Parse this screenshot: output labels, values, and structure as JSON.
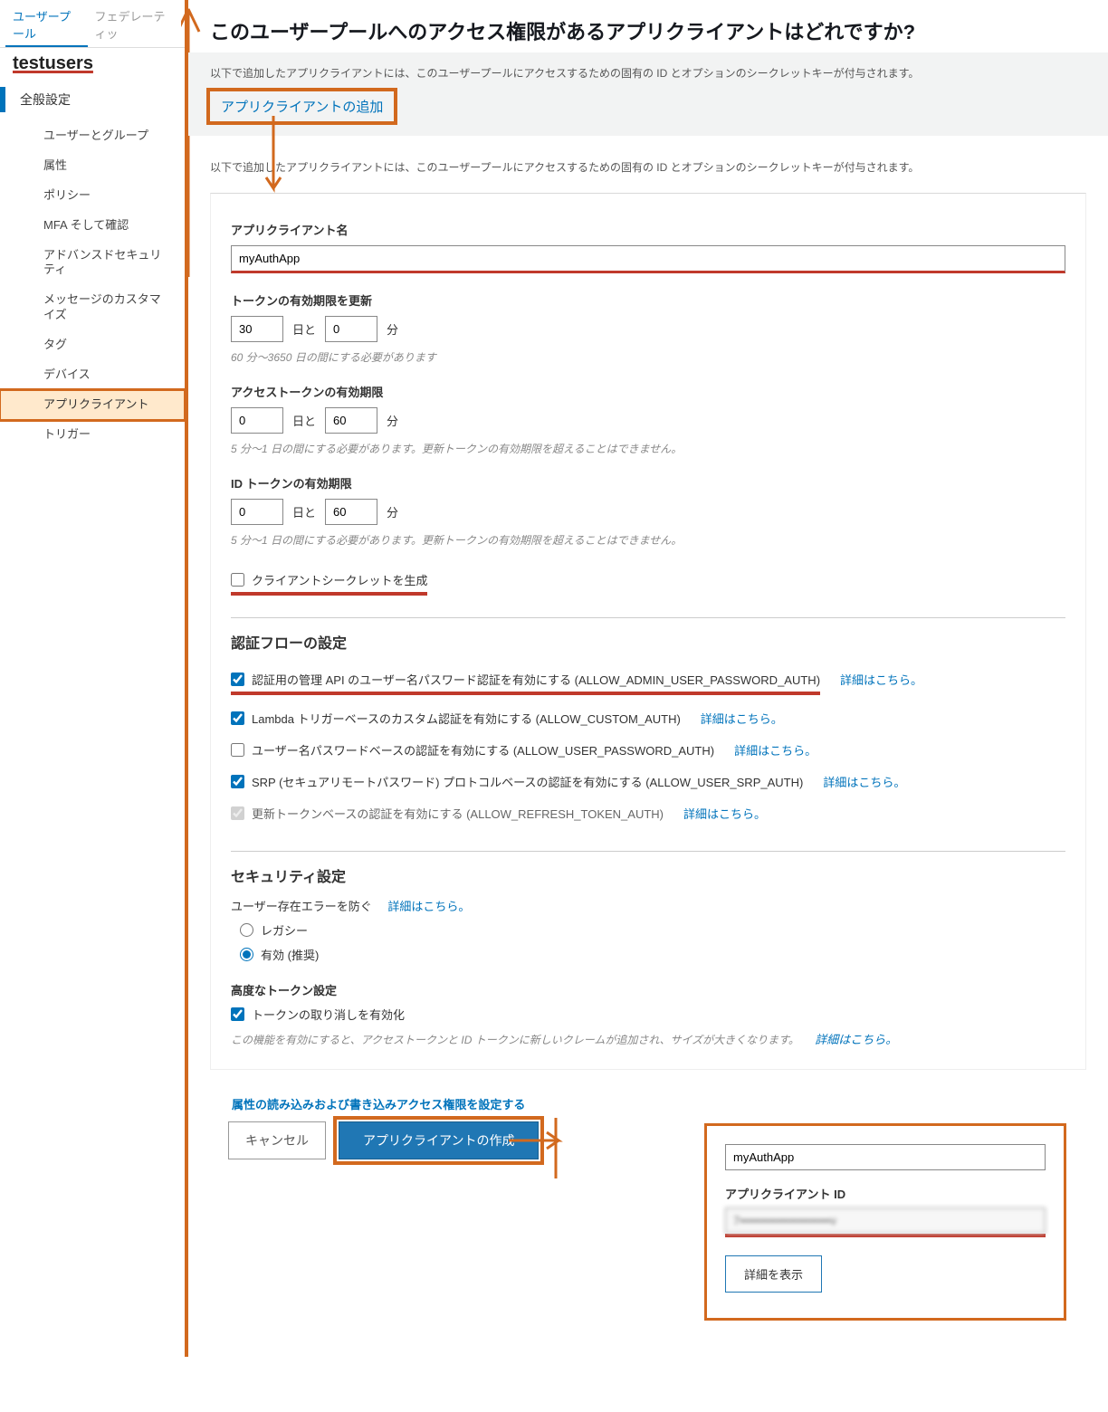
{
  "sidebar": {
    "tabs": {
      "active": "ユーザープール",
      "inactive": "フェデレーティッ"
    },
    "pool_name": "testusers",
    "section": "全般設定",
    "items": [
      "ユーザーとグループ",
      "属性",
      "ポリシー",
      "MFA そして確認",
      "アドバンスドセキュリティ",
      "メッセージのカスタマイズ",
      "タグ",
      "デバイス",
      "アプリクライアント",
      "トリガー"
    ],
    "selected_index": 8
  },
  "page": {
    "title": "このユーザープールへのアクセス権限があるアプリクライアントはどれですか?",
    "helper1": "以下で追加したアプリクライアントには、このユーザープールにアクセスするための固有の ID とオプションのシークレットキーが付与されます。",
    "add_button": "アプリクライアントの追加",
    "helper2": "以下で追加したアプリクライアントには、このユーザープールにアクセスするための固有の ID とオプションのシークレットキーが付与されます。"
  },
  "form": {
    "name_label": "アプリクライアント名",
    "name_value": "myAuthApp",
    "refresh_label": "トークンの有効期限を更新",
    "refresh_days": "30",
    "refresh_minutes": "0",
    "unit_days": "日と",
    "unit_minutes": "分",
    "refresh_hint": "60 分〜3650 日の間にする必要があります",
    "access_label": "アクセストークンの有効期限",
    "access_days": "0",
    "access_minutes": "60",
    "access_hint": "5 分〜1 日の間にする必要があります。更新トークンの有効期限を超えることはできません。",
    "id_label": "ID トークンの有効期限",
    "id_days": "0",
    "id_minutes": "60",
    "id_hint": "5 分〜1 日の間にする必要があります。更新トークンの有効期限を超えることはできません。",
    "secret_label": "クライアントシークレットを生成",
    "auth_section": "認証フローの設定",
    "auth_flows": [
      {
        "checked": true,
        "label": "認証用の管理 API のユーザー名パスワード認証を有効にする (ALLOW_ADMIN_USER_PASSWORD_AUTH)",
        "learn": "詳細はこちら。"
      },
      {
        "checked": true,
        "label": "Lambda トリガーベースのカスタム認証を有効にする (ALLOW_CUSTOM_AUTH)",
        "learn": "詳細はこちら。"
      },
      {
        "checked": false,
        "label": "ユーザー名パスワードベースの認証を有効にする (ALLOW_USER_PASSWORD_AUTH)",
        "learn": "詳細はこちら。"
      },
      {
        "checked": true,
        "label": "SRP (セキュアリモートパスワード) プロトコルベースの認証を有効にする (ALLOW_USER_SRP_AUTH)",
        "learn": "詳細はこちら。"
      },
      {
        "checked": true,
        "disabled": true,
        "label": "更新トークンベースの認証を有効にする (ALLOW_REFRESH_TOKEN_AUTH)",
        "learn": "詳細はこちら。"
      }
    ],
    "security_section": "セキュリティ設定",
    "user_exist_label": "ユーザー存在エラーを防ぐ",
    "radio_legacy": "レガシー",
    "radio_enabled": "有効 (推奨)",
    "token_section": "高度なトークン設定",
    "token_revoke": "トークンの取り消しを有効化",
    "token_hint": "この機能を有効にすると、アクセストークンと ID トークンに新しいクレームが追加され、サイズが大きくなります。",
    "learn_more": "詳細はこちら。",
    "attr_link": "属性の読み込みおよび書き込みアクセス権限を設定する",
    "cancel": "キャンセル",
    "create": "アプリクライアントの作成"
  },
  "result": {
    "name_value": "myAuthApp",
    "id_label": "アプリクライアント ID",
    "id_value": "7••••••••••••••••••••••v",
    "detail_button": "詳細を表示"
  }
}
